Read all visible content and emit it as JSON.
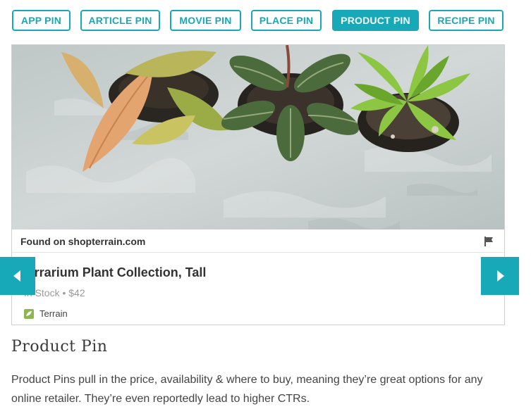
{
  "tabs": [
    {
      "label": "APP PIN",
      "active": false
    },
    {
      "label": "ARTICLE PIN",
      "active": false
    },
    {
      "label": "MOVIE PIN",
      "active": false
    },
    {
      "label": "PLACE PIN",
      "active": false
    },
    {
      "label": "PRODUCT PIN",
      "active": true
    },
    {
      "label": "RECIPE PIN",
      "active": false
    }
  ],
  "pin": {
    "found_on": "Found on shopterrain.com",
    "title": "Terrarium Plant Collection, Tall",
    "meta": "In Stock • $42",
    "brand": "Terrain"
  },
  "carousel": {
    "prev_icon": "triangle-left-icon",
    "next_icon": "triangle-right-icon"
  },
  "section": {
    "title": "Product Pin",
    "description": "Product Pins pull in the price, availability & where to buy, meaning they’re great options for any online retailer. They’re even reportedly lead to higher CTRs."
  },
  "colors": {
    "accent": "#17a9b8",
    "text": "#333333",
    "muted": "#9a9a9a"
  }
}
